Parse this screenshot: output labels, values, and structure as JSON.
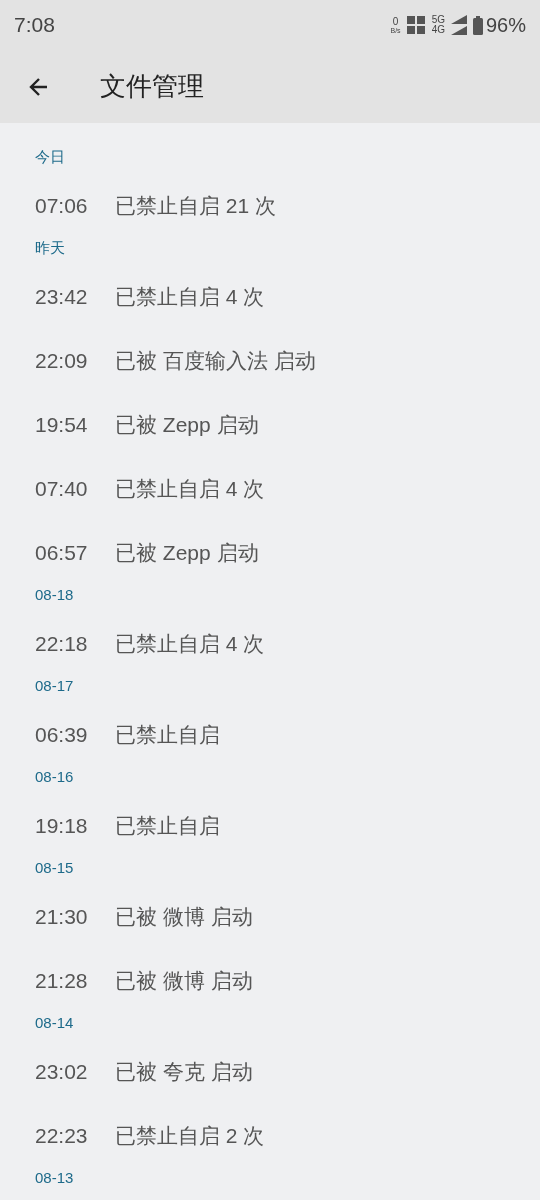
{
  "status_bar": {
    "time": "7:08",
    "net_speed": "0",
    "net_unit": "B/s",
    "network_top": "5G",
    "network_bottom": "4G",
    "battery": "96%"
  },
  "app_bar": {
    "title": "文件管理"
  },
  "groups": [
    {
      "date": "今日",
      "entries": [
        {
          "time": "07:06",
          "text": "已禁止自启 21 次"
        }
      ]
    },
    {
      "date": "昨天",
      "entries": [
        {
          "time": "23:42",
          "text": "已禁止自启 4 次"
        },
        {
          "time": "22:09",
          "text": "已被 百度输入法 启动"
        },
        {
          "time": "19:54",
          "text": "已被 Zepp 启动"
        },
        {
          "time": "07:40",
          "text": "已禁止自启 4 次"
        },
        {
          "time": "06:57",
          "text": "已被 Zepp 启动"
        }
      ]
    },
    {
      "date": "08-18",
      "entries": [
        {
          "time": "22:18",
          "text": "已禁止自启 4 次"
        }
      ]
    },
    {
      "date": "08-17",
      "entries": [
        {
          "time": "06:39",
          "text": "已禁止自启"
        }
      ]
    },
    {
      "date": "08-16",
      "entries": [
        {
          "time": "19:18",
          "text": "已禁止自启"
        }
      ]
    },
    {
      "date": "08-15",
      "entries": [
        {
          "time": "21:30",
          "text": "已被 微博 启动"
        },
        {
          "time": "21:28",
          "text": "已被 微博 启动"
        }
      ]
    },
    {
      "date": "08-14",
      "entries": [
        {
          "time": "23:02",
          "text": "已被 夸克 启动"
        },
        {
          "time": "22:23",
          "text": "已禁止自启 2 次"
        }
      ]
    },
    {
      "date": "08-13"
    }
  ]
}
